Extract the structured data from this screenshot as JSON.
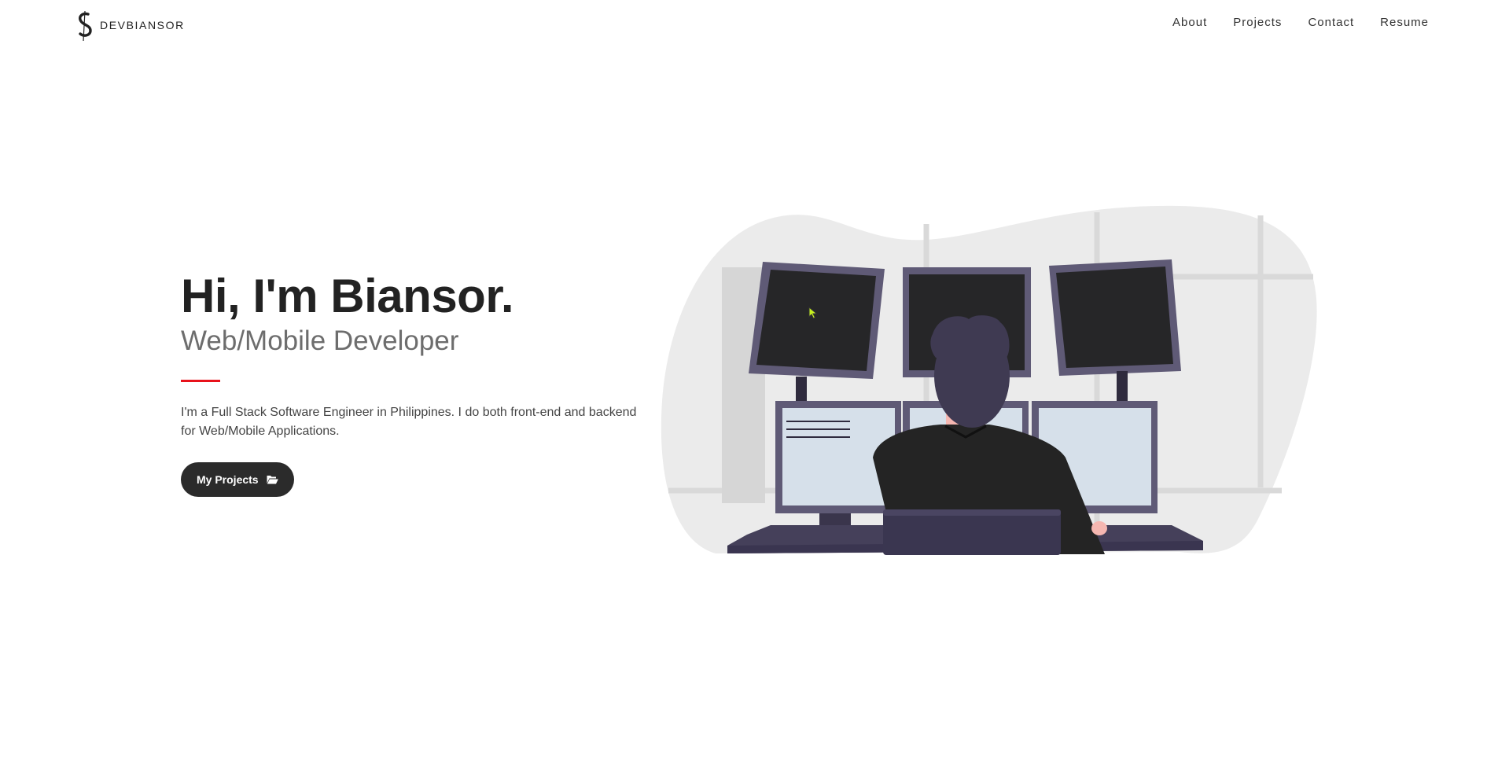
{
  "nav": {
    "brand": "DEVBIANSOR",
    "links": [
      "About",
      "Projects",
      "Contact",
      "Resume"
    ]
  },
  "hero": {
    "title": "Hi, I'm Biansor.",
    "subtitle": "Web/Mobile Developer",
    "description": "I'm a Full Stack Software Engineer in Philippines. I do both front-end and backend for Web/Mobile Applications.",
    "button_label": "My Projects"
  },
  "colors": {
    "accent": "#e8121b",
    "button_bg": "#2b2b2b",
    "text_dark": "#222222",
    "subtitle": "#6d6d6d",
    "blob_bg": "#ebebeb",
    "monitor_frame": "#5f5a76",
    "screen_dark": "#262628",
    "screen_light": "#d6e0ea",
    "person_hair": "#3f3a52",
    "person_jacket": "#242424",
    "skin": "#f5b7b1"
  },
  "icons": {
    "brand": "dollar-s-logo-icon",
    "button": "folder-open-icon",
    "cursor": "mouse-pointer-icon"
  }
}
